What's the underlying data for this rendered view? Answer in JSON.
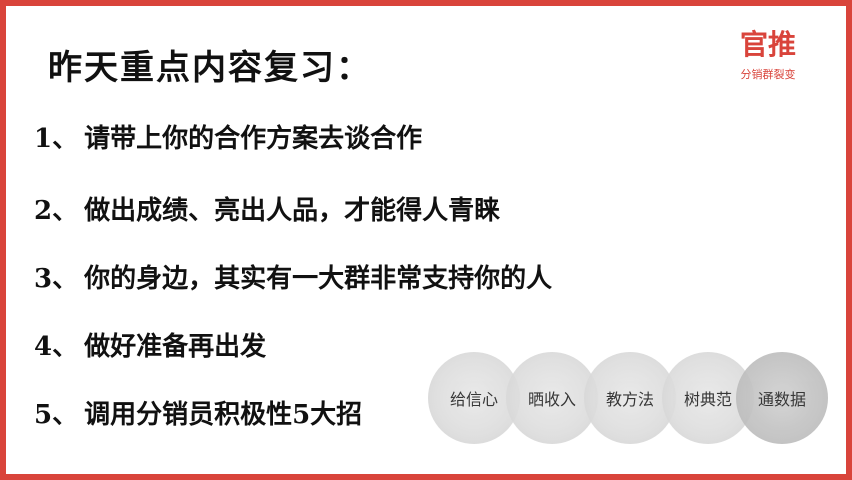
{
  "title": "昨天重点内容复习：",
  "logo": {
    "main": "官推",
    "sub": "分销群裂变"
  },
  "items": [
    {
      "num": "1、",
      "text": "请带上你的合作方案去谈合作"
    },
    {
      "num": "2、",
      "text": "做出成绩、亮出人品，才能得人青睐"
    },
    {
      "num": "3、",
      "text": "你的身边，其实有一大群非常支持你的人"
    },
    {
      "num": "4、",
      "text": "做好准备再出发"
    },
    {
      "num": "5、",
      "text": "调用分销员积极性5大招"
    }
  ],
  "circles": [
    "给信心",
    "晒收入",
    "教方法",
    "树典范",
    "通数据"
  ],
  "colors": {
    "accent": "#d9443b"
  }
}
